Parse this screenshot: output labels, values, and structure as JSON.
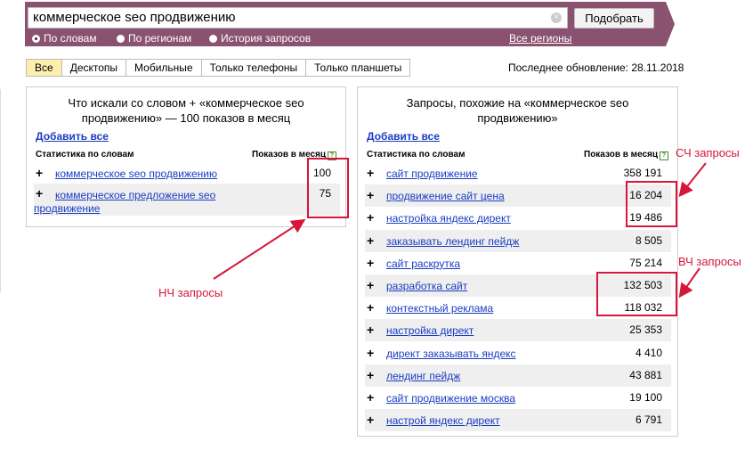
{
  "search": {
    "query": "коммерческое seo продвижению",
    "submit_label": "Подобрать",
    "radio_options": [
      {
        "label": "По словам",
        "selected": true
      },
      {
        "label": "По регионам",
        "selected": false
      },
      {
        "label": "История запросов",
        "selected": false
      }
    ],
    "regions_link": "Все регионы"
  },
  "tabs": [
    "Все",
    "Десктопы",
    "Мобильные",
    "Только телефоны",
    "Только планшеты"
  ],
  "active_tab": "Все",
  "last_update": "Последнее обновление: 28.11.2018",
  "left_panel": {
    "title_line1": "Что искали со словом  + «коммерческое seo",
    "title_line2": "продвижению» — 100 показов в месяц",
    "add_all": "Добавить все",
    "col_keyword": "Статистика по словам",
    "col_count": "Показов в месяц",
    "rows": [
      {
        "keyword": "коммерческое seo продвижению",
        "count": "100"
      },
      {
        "keyword_line1": "коммерческое предложение seo",
        "keyword_line2": "продвижение",
        "count": "75"
      }
    ]
  },
  "right_panel": {
    "title_line1": "Запросы, похожие на «коммерческое seo",
    "title_line2": "продвижению»",
    "add_all": "Добавить все",
    "col_keyword": "Статистика по словам",
    "col_count": "Показов в месяц",
    "rows": [
      {
        "keyword": "сайт продвижение",
        "count": "358 191"
      },
      {
        "keyword": "продвижение сайт цена",
        "count": "16 204"
      },
      {
        "keyword": "настройка яндекс директ",
        "count": "19 486"
      },
      {
        "keyword": "заказывать лендинг пейдж",
        "count": "8 505"
      },
      {
        "keyword": "сайт раскрутка",
        "count": "75 214"
      },
      {
        "keyword": "разработка сайт",
        "count": "132 503"
      },
      {
        "keyword": "контекстный реклама",
        "count": "118 032"
      },
      {
        "keyword": "настройка директ",
        "count": "25 353"
      },
      {
        "keyword": "директ заказывать яндекс",
        "count": "4 410"
      },
      {
        "keyword": "лендинг пейдж",
        "count": "43 881"
      },
      {
        "keyword": "сайт продвижение москва",
        "count": "19 100"
      },
      {
        "keyword": "настрой яндекс директ",
        "count": "6 791"
      }
    ]
  },
  "annotations": {
    "low_freq": "НЧ запросы",
    "mid_freq": "СЧ запросы",
    "high_freq": "ВЧ запросы",
    "color": "#d6163b"
  },
  "colors": {
    "header_bg": "#8a5270",
    "active_tab_bg": "#fcefae",
    "link": "#1a3dc1"
  }
}
